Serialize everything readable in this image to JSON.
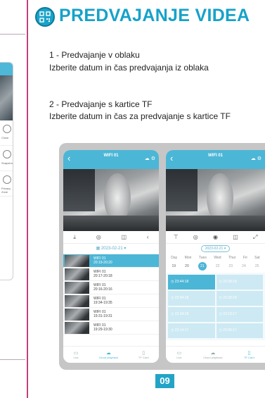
{
  "title": "PREDVAJANJE VIDEA",
  "section1": {
    "heading": "1 - Predvajanje v oblaku",
    "body": "Izberite datum in čas predvajanja iz oblaka"
  },
  "section2": {
    "heading": "2 - Predvajanje s kartice TF",
    "body": "Izberite datum in čas za predvajanje s kartice TF"
  },
  "left_panel": {
    "items": [
      "Close",
      "Snapshot",
      "Privacy Zone"
    ]
  },
  "phone_a": {
    "device_name": "WIFI 01",
    "date": "2023-02-21",
    "records": [
      {
        "name": "WIFI 01",
        "time": "20:19-20:20"
      },
      {
        "name": "WIFI 01",
        "time": "20:17-20:18"
      },
      {
        "name": "WIFI 01",
        "time": "20:16-20:16"
      },
      {
        "name": "WIFI 01",
        "time": "19:34-19:35"
      },
      {
        "name": "WIFI 01",
        "time": "19:31-19:31"
      },
      {
        "name": "WIFI 01",
        "time": "19:29-19:30"
      }
    ],
    "nav": [
      {
        "label": "Live",
        "icon": "video-icon"
      },
      {
        "label": "Cloud playback",
        "icon": "cloud-icon"
      },
      {
        "label": "TF Card",
        "icon": "sd-card-icon"
      }
    ]
  },
  "phone_b": {
    "device_name": "WIFI 01",
    "date": "2023-02-21",
    "weekdays": [
      "Day",
      "Mon",
      "Tues",
      "Wed",
      "Thur",
      "Fri",
      "Sat"
    ],
    "days": [
      "19",
      "20",
      "21",
      "22",
      "23",
      "24",
      "25"
    ],
    "selected_day": "21",
    "slots": [
      "23:44:18",
      "23:39:18",
      "23:34:18",
      "23:29:18",
      "23:24:18",
      "23:19:17",
      "23:14:17",
      "23:09:17"
    ],
    "nav": [
      {
        "label": "Live",
        "icon": "video-icon"
      },
      {
        "label": "Cloud playback",
        "icon": "cloud-icon"
      },
      {
        "label": "TF Card",
        "icon": "sd-card-icon"
      }
    ]
  },
  "page_number": "09",
  "colors": {
    "accent": "#16a2c9",
    "app_header": "#4cb6d6",
    "divider": "#c0407e",
    "frame": "#c6c6c6"
  }
}
